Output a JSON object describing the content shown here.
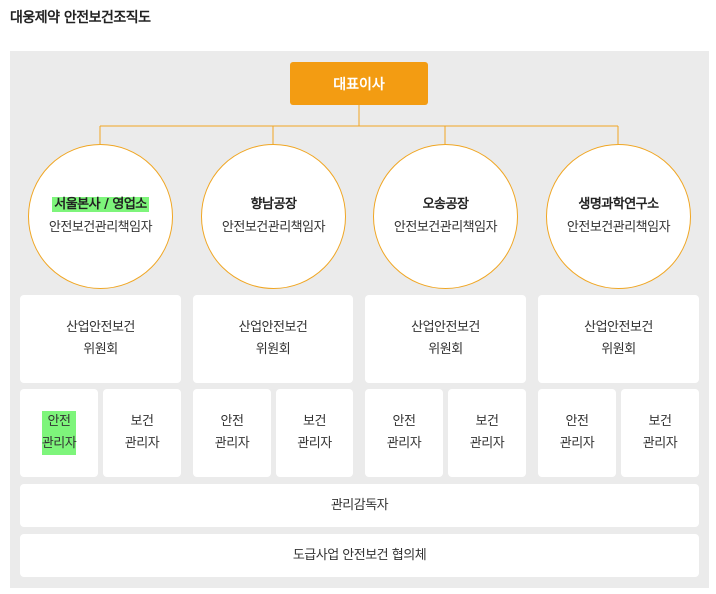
{
  "page": {
    "title": "대웅제약 안전보건조직도"
  },
  "ceo": {
    "label": "대표이사"
  },
  "colors": {
    "accent": "#f39c12",
    "panel": "#ebebeb",
    "highlight": "#7ef57b"
  },
  "sites": [
    {
      "name": "서울본사 / 영업소",
      "role": "안전보건관리책임자",
      "committee_line1": "산업안전보건",
      "committee_line2": "위원회",
      "safety_line1": "안전",
      "safety_line2": "관리자",
      "health_line1": "보건",
      "health_line2": "관리자"
    },
    {
      "name": "향남공장",
      "role": "안전보건관리책임자",
      "committee_line1": "산업안전보건",
      "committee_line2": "위원회",
      "safety_line1": "안전",
      "safety_line2": "관리자",
      "health_line1": "보건",
      "health_line2": "관리자"
    },
    {
      "name": "오송공장",
      "role": "안전보건관리책임자",
      "committee_line1": "산업안전보건",
      "committee_line2": "위원회",
      "safety_line1": "안전",
      "safety_line2": "관리자",
      "health_line1": "보건",
      "health_line2": "관리자"
    },
    {
      "name": "생명과학연구소",
      "role": "안전보건관리책임자",
      "committee_line1": "산업안전보건",
      "committee_line2": "위원회",
      "safety_line1": "안전",
      "safety_line2": "관리자",
      "health_line1": "보건",
      "health_line2": "관리자"
    }
  ],
  "supervisor": {
    "label": "관리감독자"
  },
  "subcontract": {
    "label": "도급사업 안전보건 협의체"
  }
}
